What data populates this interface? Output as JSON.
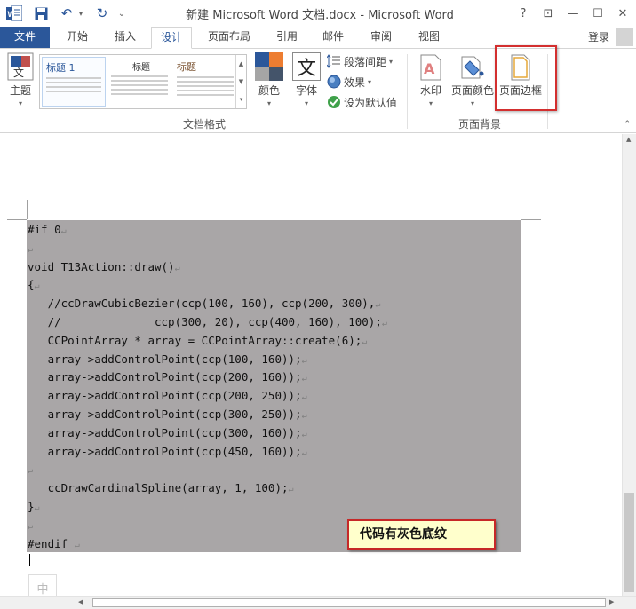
{
  "titlebar": {
    "title": "新建 Microsoft Word 文档.docx - Microsoft Word",
    "word_icon": "W",
    "save_icon": "save-icon",
    "undo_icon": "↶",
    "redo_icon": "↻",
    "customize_icon": "⌄",
    "help": "?",
    "restore_ribbon": "⊡",
    "minimize": "—",
    "maximize": "☐",
    "close": "✕"
  },
  "tabs": {
    "file": "文件",
    "items": [
      "开始",
      "插入",
      "设计",
      "页面布局",
      "引用",
      "邮件",
      "审阅",
      "视图"
    ],
    "active": "设计",
    "login": "登录"
  },
  "ribbon": {
    "theme_label": "主题",
    "gallery": {
      "item1_heading": "标题 1",
      "item2_heading": "标题",
      "item3_heading": "标题"
    },
    "colors_label": "颜色",
    "fonts_label": "字体",
    "fonts_icon_glyph": "文",
    "paragraph_spacing": "段落间距",
    "effects": "效果",
    "set_default": "设为默认值",
    "group_doc_format": "文档格式",
    "watermark": "水印",
    "page_color": "页面颜色",
    "page_borders": "页面边框",
    "group_page_background": "页面背景"
  },
  "document": {
    "code_lines": [
      "#if 0",
      "",
      "void T13Action::draw()",
      "{",
      "   //ccDrawCubicBezier(ccp(100, 160), ccp(200, 300),",
      "   //              ccp(300, 20), ccp(400, 160), 100);",
      "   CCPointArray * array = CCPointArray::create(6);",
      "   array->addControlPoint(ccp(100, 160));",
      "   array->addControlPoint(ccp(200, 160));",
      "   array->addControlPoint(ccp(200, 250));",
      "   array->addControlPoint(ccp(300, 250));",
      "   array->addControlPoint(ccp(300, 160));",
      "   array->addControlPoint(ccp(450, 160));",
      "",
      "   ccDrawCardinalSpline(array, 1, 100);",
      "}",
      "",
      "#endif "
    ],
    "paragraph_mark": "↵",
    "note": "代码有灰色底纹",
    "ime_indicator": "中"
  },
  "colors": {
    "accent": "#2b579a",
    "code_shading": "#a9a6a7",
    "highlight_border": "#d32f2f"
  }
}
